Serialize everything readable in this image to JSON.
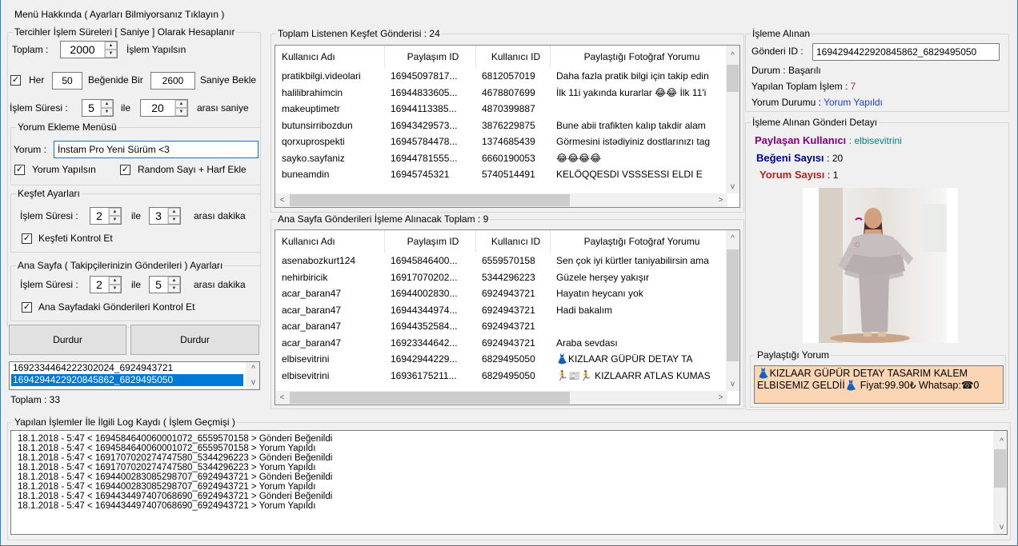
{
  "menu": {
    "label": "Menü Hakkında ( Ayarları Bilmiyorsanız Tıklayın )"
  },
  "prefs": {
    "title": "Tercihler İşlem Süreleri [ Saniye ] Olarak Hesaplanır",
    "toplam_label": "Toplam :",
    "toplam_value": "2000",
    "islem_yapilsin": "İşlem Yapılsın",
    "her_label": "Her",
    "her_value": "50",
    "begenide_bir": "Beğenide Bir",
    "saniye_value": "2600",
    "saniye_bekle": "Saniye Bekle",
    "islem_suresi_label": "İşlem Süresi :",
    "min_value": "5",
    "ile": "ile",
    "max_value": "20",
    "arasi_saniye": "arası saniye"
  },
  "yorum_menu": {
    "title": "Yorum Ekleme Menüsü",
    "yorum_label": "Yorum :",
    "yorum_value": "İnstam Pro Yeni Sürüm <3",
    "yorum_yapilsin": "Yorum Yapılsın",
    "random": "Random Sayı + Harf Ekle"
  },
  "kesfet": {
    "title": "Keşfet Ayarları",
    "islem_suresi_label": "İşlem Süresi :",
    "min_value": "2",
    "ile": "ile",
    "max_value": "3",
    "arasi_dakika": "arası dakika",
    "kontrol": "Keşfeti Kontrol Et"
  },
  "anasayfa": {
    "title": "Ana Sayfa ( Takipçilerinizin Gönderileri ) Ayarları",
    "islem_suresi_label": "İşlem Süresi :",
    "min_value": "2",
    "ile": "ile",
    "max_value": "5",
    "arasi_dakika": "arası dakika",
    "kontrol": "Ana Sayfadaki Gönderileri Kontrol Et"
  },
  "buttons": {
    "durdur1": "Durdur",
    "durdur2": "Durdur"
  },
  "idlist": {
    "items": [
      "1692334464222302024_6924943721",
      "1694294422920845862_6829495050"
    ],
    "selected_index": 1,
    "toplam": "Toplam :  33"
  },
  "kesfet_list": {
    "title": "Toplam Listenen Keşfet Gönderisi : 24",
    "columns": [
      "Kullanıcı Adı",
      "Paylaşım ID",
      "Kullanıcı ID",
      "Paylaştığı Fotoğraf Yorumu"
    ],
    "rows": [
      [
        "pratikbilgi.videolari",
        "16945097817...",
        "6812057019",
        "Daha fazla pratik bilgi için takip edin"
      ],
      [
        "halilibrahimcin",
        "16944833605...",
        "4678807699",
        "İlk 11i yakında kurarlar 😂😂 İlk 11'i"
      ],
      [
        "makeuptimetr",
        "16944113385...",
        "4870399887",
        ""
      ],
      [
        "butunsirribozdun",
        "16943429573...",
        "3876229875",
        "Bune abii trafikten kalıp takdir alam"
      ],
      [
        "qorxuprospekti",
        "16945784478...",
        "1374685439",
        "Görmesini istədiyiniz dostlarınızı tag"
      ],
      [
        "sayko.sayfaniz",
        "16944781555...",
        "6660190053",
        "😂😂😂😂"
      ],
      [
        "buneamdin",
        "16945745321",
        "5740514491",
        "KELÖQQESDI VSSSESSI ELDI E"
      ]
    ]
  },
  "ana_list": {
    "title": "Ana Sayfa Gönderileri İşleme Alınacak Toplam : 9",
    "columns": [
      "Kullanıcı Adı",
      "Paylaşım ID",
      "Kullanıcı ID",
      "Paylaştığı Fotoğraf Yorumu"
    ],
    "rows": [
      [
        "asenabozkurt124",
        "16945846400...",
        "6559570158",
        "Sen çok iyi kürtler taniyabilirsin ama"
      ],
      [
        "nehirbiricik",
        "16917070202...",
        "5344296223",
        "Güzele herşey yakışır"
      ],
      [
        "acar_baran47",
        "16944002830...",
        "6924943721",
        "Hayatın heycanı yok"
      ],
      [
        "acar_baran47",
        "16944344974...",
        "6924943721",
        "Hadi bakalım"
      ],
      [
        "acar_baran47",
        "16944352584...",
        "6924943721",
        ""
      ],
      [
        "acar_baran47",
        "16923344642...",
        "6924943721",
        "Araba sevdası"
      ],
      [
        "elbisevitrini",
        "16942944229...",
        "6829495050",
        "👗KIZLAAR GÜPÜR DETAY TA"
      ],
      [
        "elbisevitrini",
        "16936175211...",
        "6829495050",
        "🏃📰🏃 KIZLAARR ATLAS KUMAS"
      ]
    ]
  },
  "isleme": {
    "title": "İşleme Alınan",
    "gonderi_label": "Gönderi ID :",
    "gonderi_value": "1694294422920845862_6829495050",
    "durum_label": "Durum :",
    "durum_value": "Başarılı",
    "toplam_label": "Yapılan Toplam İşlem :",
    "toplam_value": "7",
    "yorum_label": "Yorum Durumu :",
    "yorum_value": "Yorum Yapıldı"
  },
  "detay": {
    "title": "İşleme Alınan Gönderi Detayı",
    "paylasan_label": "Paylaşan Kullanıcı",
    "paylasan_value": ": elbisevitrini",
    "begeni_label": "Beğeni Sayısı",
    "begeni_value": ": 20",
    "yorum_label": "Yorum Sayısı",
    "yorum_value": ":  1",
    "paylastigi_yorum_title": "Paylaştığı Yorum",
    "paylastigi_yorum_text": "👗KIZLAAR GÜPÜR DETAY TASARIM KALEM ELBISEMIZ GELDİİ👗 Fiyat:99.90₺ Whatsap:☎0"
  },
  "log": {
    "title": "Yapılan İşlemler İle İlgili Log Kaydı ( İşlem Geçmişi )",
    "lines": [
      "18.1.2018 - 5:47 < 1694584640060001072_6559570158 > Gönderi Beğenildi",
      "18.1.2018 - 5:47 < 1694584640060001072_6559570158 > Yorum Yapıldı",
      "18.1.2018 - 5:47 < 1691707020274747580_5344296223 > Gönderi Beğenildi",
      "18.1.2018 - 5:47 < 1691707020274747580_5344296223 > Yorum Yapıldı",
      "18.1.2018 - 5:47 < 1694400283085298707_6924943721 > Gönderi Beğenildi",
      "18.1.2018 - 5:47 < 1694400283085298707_6924943721 > Yorum Yapıldı",
      "18.1.2018 - 5:47 < 1694434497407068690_6924943721 > Gönderi Beğenildi",
      "18.1.2018 - 5:47 < 1694434497407068690_6924943721 > Yorum Yapıldı"
    ]
  },
  "colors": {
    "accent": "#1883d7",
    "selection": "#0078d7",
    "purple": "#800080",
    "navy": "#00008b",
    "red": "#b22222",
    "teal": "#008080",
    "comment_bg": "#fcd5b4"
  }
}
